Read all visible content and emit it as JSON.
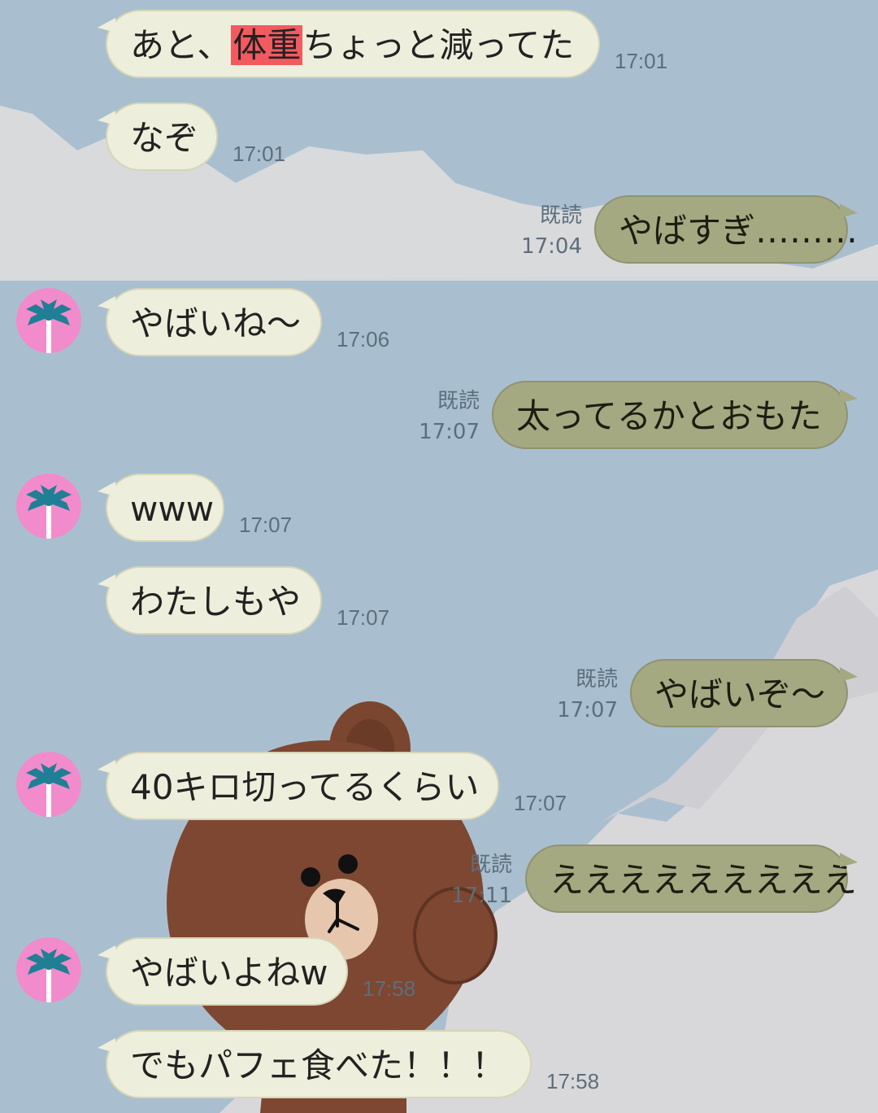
{
  "messages": [
    {
      "side": "in",
      "avatar": false,
      "pre": "あと、",
      "highlight": "体重",
      "post": "ちょっと減ってた",
      "time": "17:01"
    },
    {
      "side": "in",
      "avatar": false,
      "text": "なぞ",
      "time": "17:01"
    },
    {
      "side": "out",
      "read": "既読",
      "text": "やばすぎ………",
      "time": "17:04"
    },
    {
      "side": "in",
      "avatar": true,
      "text": "やばいね〜",
      "time": "17:06"
    },
    {
      "side": "out",
      "read": "既読",
      "text": "太ってるかとおもた",
      "time": "17:07"
    },
    {
      "side": "in",
      "avatar": true,
      "text": "www",
      "time": "17:07"
    },
    {
      "side": "in",
      "avatar": false,
      "text": "わたしもや",
      "time": "17:07"
    },
    {
      "side": "out",
      "read": "既読",
      "text": "やばいぞ〜",
      "time": "17:07"
    },
    {
      "side": "in",
      "avatar": true,
      "text": "40キロ切ってるくらい",
      "time": "17:07"
    },
    {
      "side": "out",
      "read": "既読",
      "text": "えええええええええ",
      "time": "17:11"
    },
    {
      "side": "in",
      "avatar": true,
      "text": "やばいよねw",
      "time": "17:58"
    },
    {
      "side": "in",
      "avatar": false,
      "text": "でもパフェ食べた！！！",
      "time": "17:58"
    }
  ],
  "avatar_icon": "palm-tree-icon",
  "colors": {
    "background": "#a9bfd0",
    "incoming_bubble": "#eeeedc",
    "outgoing_bubble": "#a5a981",
    "highlight": "#f25a5f",
    "avatar": "#f28bcb"
  }
}
